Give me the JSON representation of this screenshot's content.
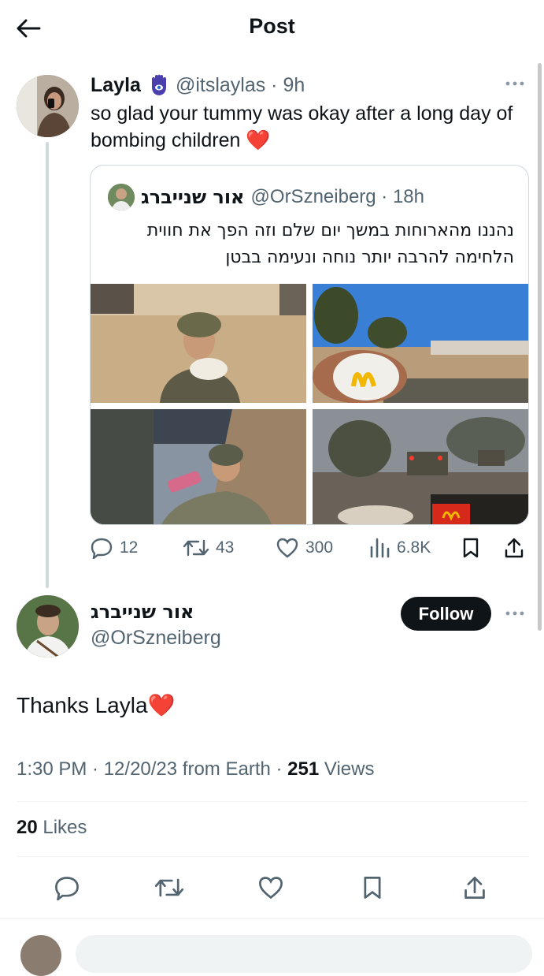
{
  "header": {
    "title": "Post"
  },
  "tweet": {
    "name": "Layla",
    "handle": "@itslaylas",
    "time": "9h",
    "text": "so glad your tummy was okay after a long day of bombing children",
    "heart_emoji": "❤️",
    "badge_icon": "hamsa-icon"
  },
  "quote": {
    "name": "אור שנייברג",
    "handle": "@OrSzneiberg",
    "time": "18h",
    "text_line1": "נהננו מהארוחות במשך יום שלם וזה הפך את חווית",
    "text_line2": "הלחימה להרבה יותר נוחה ונעימה בבטן"
  },
  "actions": {
    "replies": "12",
    "retweets": "43",
    "likes": "300",
    "views": "6.8K"
  },
  "reply": {
    "name": "אור שנייברג",
    "handle": "@OrSzneiberg",
    "follow_label": "Follow",
    "text": "Thanks Layla",
    "heart_emoji": "❤️",
    "time_date": "1:30 PM · 12/20/23 from Earth · ",
    "views_count": "251",
    "views_label": " Views",
    "likes_count": "20",
    "likes_label": " Likes"
  },
  "colors": {
    "text": "#0f1419",
    "muted": "#536471",
    "border": "#cfd9de",
    "heart": "#e0245e",
    "follow_bg": "#0f1419"
  }
}
